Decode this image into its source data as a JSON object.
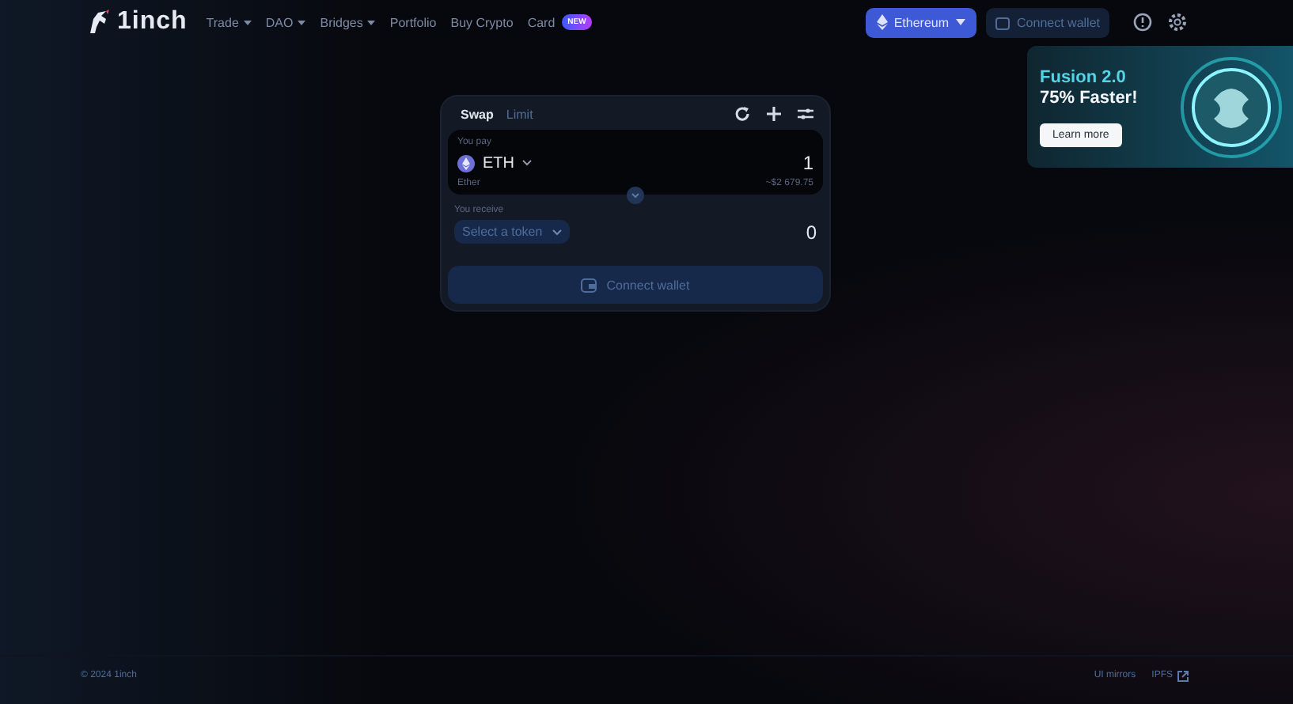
{
  "header": {
    "logo": "1inch",
    "nav": [
      {
        "label": "Trade",
        "dropdown": true
      },
      {
        "label": "DAO",
        "dropdown": true
      },
      {
        "label": "Bridges",
        "dropdown": true
      },
      {
        "label": "Portfolio",
        "dropdown": false
      },
      {
        "label": "Buy Crypto",
        "dropdown": false
      },
      {
        "label": "Card",
        "dropdown": false,
        "badge": "NEW"
      }
    ],
    "network": "Ethereum",
    "connect": "Connect wallet"
  },
  "banner": {
    "title": "Fusion 2.0",
    "subtitle": "75% Faster!",
    "button": "Learn more"
  },
  "swap": {
    "tabs": [
      {
        "label": "Swap",
        "selected": true
      },
      {
        "label": "Limit",
        "selected": false
      }
    ],
    "pay": {
      "label": "You pay",
      "token": "ETH",
      "token_name": "Ether",
      "amount": "1",
      "usd": "~$2 679.75"
    },
    "receive": {
      "label": "You receive",
      "token": "Select a token",
      "amount": "0"
    },
    "button": "Connect wallet"
  },
  "footer": {
    "copyright": "© 2024 1inch",
    "links": [
      {
        "label": "UI mirrors",
        "external": false
      },
      {
        "label": "IPFS",
        "external": true
      }
    ]
  }
}
